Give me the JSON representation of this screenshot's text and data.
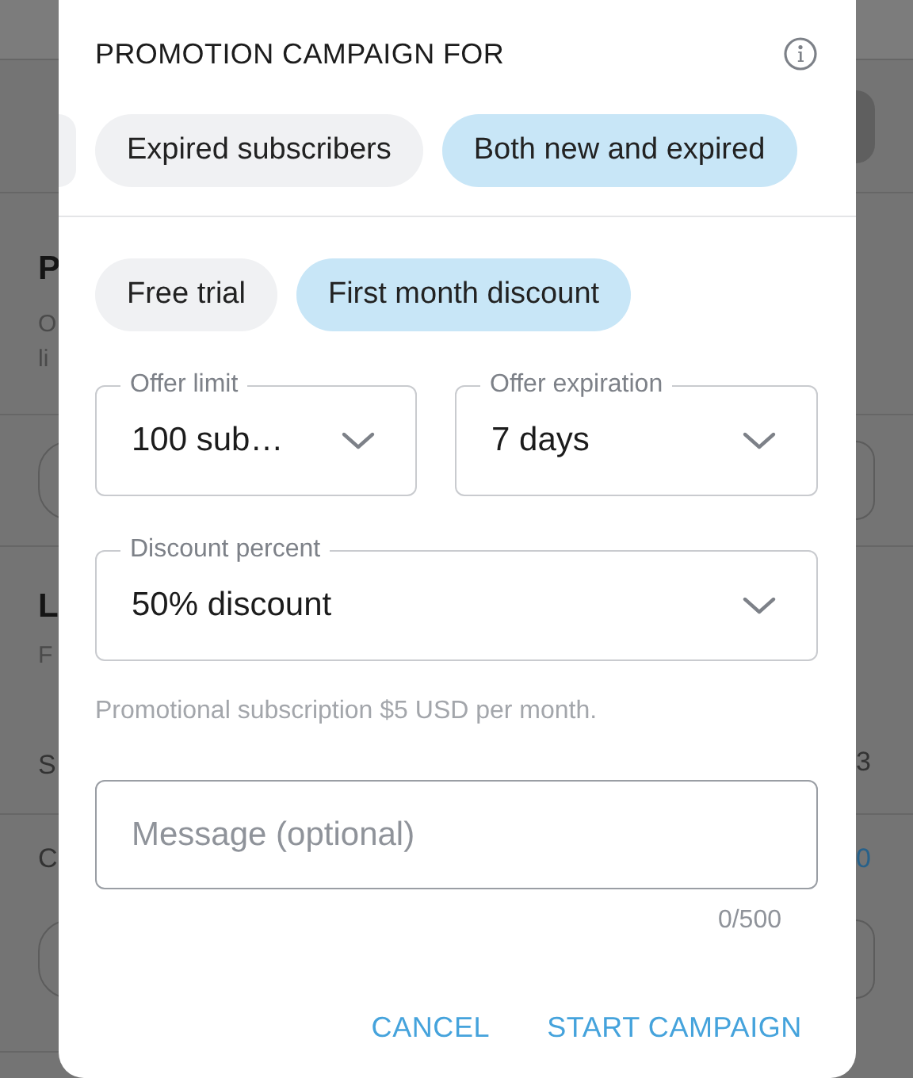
{
  "background": {
    "left": {
      "heading_1": "P",
      "text_1": "O",
      "text_2": "li",
      "heading_2": "L",
      "text_3": "F",
      "row_1": "S",
      "row_2": "C"
    },
    "right": {
      "row_1_value": "3",
      "row_2_value": "0"
    }
  },
  "dialog": {
    "title": "PROMOTION CAMPAIGN FOR",
    "audience_chips": [
      {
        "label": "Expired subscribers",
        "selected": false
      },
      {
        "label": "Both new and expired",
        "selected": true
      }
    ],
    "offer_types": [
      {
        "label": "Free trial",
        "selected": false
      },
      {
        "label": "First month discount",
        "selected": true
      }
    ],
    "offer_limit": {
      "label": "Offer limit",
      "value": "100 sub…"
    },
    "offer_expiration": {
      "label": "Offer expiration",
      "value": "7 days"
    },
    "discount_percent": {
      "label": "Discount percent",
      "value": "50% discount"
    },
    "helper_text": "Promotional subscription $5 USD per month.",
    "message": {
      "placeholder": "Message (optional)",
      "counter": "0/500"
    },
    "buttons": [
      "CANCEL",
      "START CAMPAIGN"
    ]
  }
}
